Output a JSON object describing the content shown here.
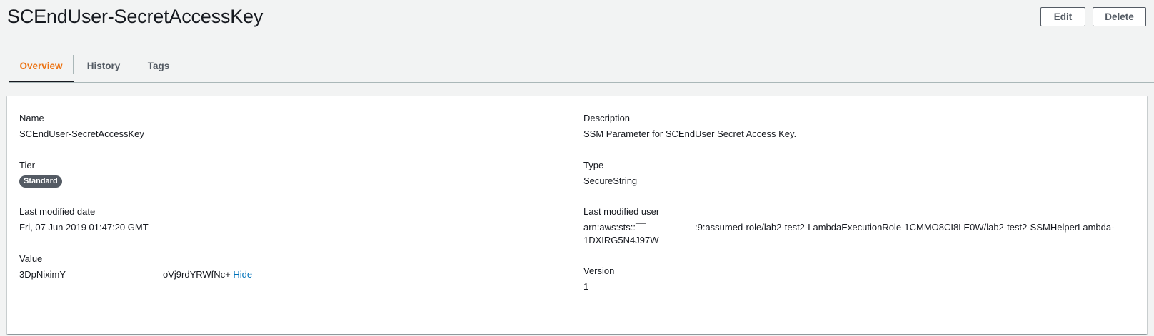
{
  "page": {
    "title": "SCEndUser-SecretAccessKey"
  },
  "actions": {
    "edit_label": "Edit",
    "delete_label": "Delete"
  },
  "tabs": [
    {
      "label": "Overview",
      "active": true
    },
    {
      "label": "History",
      "active": false
    },
    {
      "label": "Tags",
      "active": false
    }
  ],
  "overview": {
    "name": {
      "label": "Name",
      "value": "SCEndUser-SecretAccessKey"
    },
    "description": {
      "label": "Description",
      "value": "SSM Parameter for SCEndUser Secret Access Key."
    },
    "tier": {
      "label": "Tier",
      "value": "Standard"
    },
    "type": {
      "label": "Type",
      "value": "SecureString"
    },
    "last_modified_date": {
      "label": "Last modified date",
      "value": "Fri, 07 Jun 2019 01:47:20 GMT"
    },
    "last_modified_user": {
      "label": "Last modified user",
      "value_part1": "arn:aws:sts::¯¯",
      "value_part2": ":9:assumed-role/lab2-test2-LambdaExecutionRole-1CMMO8CI8LE0W/lab2-test2-SSMHelperLambda-",
      "value_line2": "1DXIRG5N4J97W"
    },
    "value": {
      "label": "Value",
      "value_part1": "3DpNiximY",
      "value_part2": "oVj9rdYRWfNc+",
      "hide_label": "Hide"
    },
    "version": {
      "label": "Version",
      "value": "1"
    }
  },
  "colors": {
    "accent_tab": "#ec7211",
    "link": "#0073bb",
    "badge_bg": "#545b64"
  }
}
